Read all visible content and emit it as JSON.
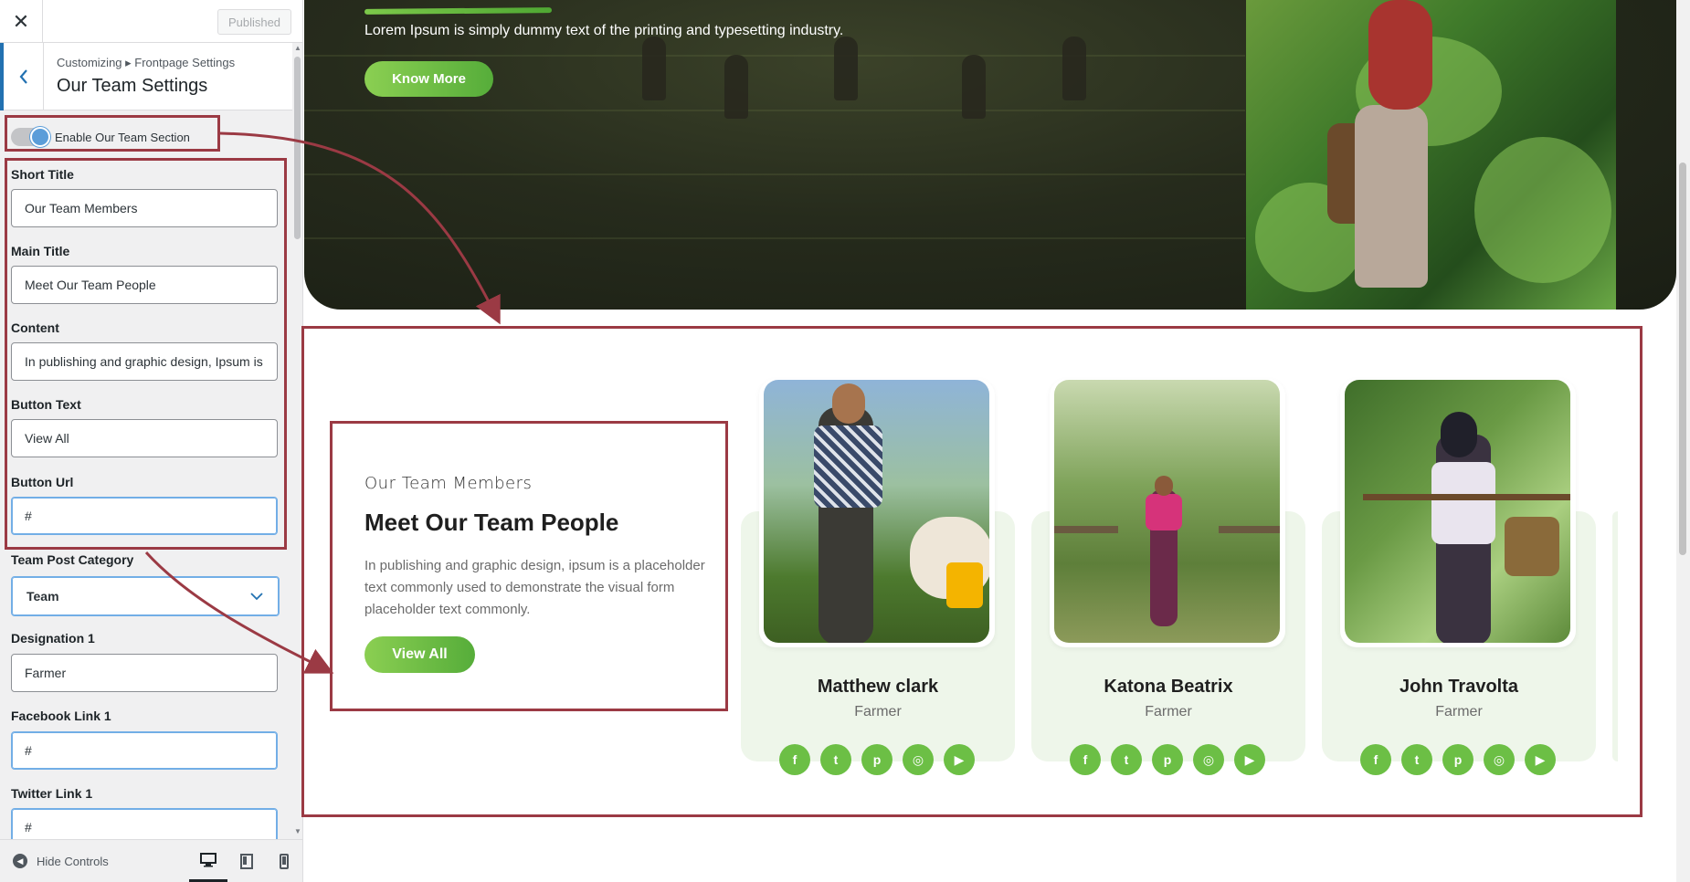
{
  "sidebar": {
    "published_label": "Published",
    "breadcrumb": "Customizing ▸ Frontpage Settings",
    "panel_title": "Our Team Settings",
    "enable_toggle_label": "Enable Our Team Section",
    "enable_toggle_on": true,
    "fields": {
      "short_title": {
        "label": "Short Title",
        "value": "Our Team Members"
      },
      "main_title": {
        "label": "Main Title",
        "value": "Meet Our Team People"
      },
      "content": {
        "label": "Content",
        "value": "In publishing and graphic design, Ipsum is"
      },
      "button_text": {
        "label": "Button Text",
        "value": "View All"
      },
      "button_url": {
        "label": "Button Url",
        "value": "#"
      },
      "team_post_category": {
        "label": "Team Post Category",
        "value": "Team"
      },
      "designation_1": {
        "label": "Designation 1",
        "value": "Farmer"
      },
      "facebook_link_1": {
        "label": "Facebook Link 1",
        "value": "#"
      },
      "twitter_link_1": {
        "label": "Twitter Link 1",
        "value": "#"
      }
    },
    "footer": {
      "hide_controls_label": "Hide Controls",
      "active_device": "desktop"
    }
  },
  "preview": {
    "hero": {
      "text": "Lorem Ipsum is simply dummy text of the printing and typesetting industry.",
      "button_label": "Know More"
    },
    "team": {
      "short_title": "Our Team Members",
      "main_title": "Meet Our Team People",
      "content": "In publishing and graphic design, ipsum is a placeholder text commonly used to demonstrate the visual form placeholder text commonly.",
      "button_label": "View All",
      "members": [
        {
          "name": "Matthew clark",
          "role": "Farmer"
        },
        {
          "name": "Katona Beatrix",
          "role": "Farmer"
        },
        {
          "name": "John Travolta",
          "role": "Farmer"
        }
      ],
      "social_icons": [
        "facebook-icon",
        "twitter-icon",
        "pinterest-icon",
        "instagram-icon",
        "youtube-icon"
      ]
    }
  },
  "colors": {
    "accent_green": "#6cbf45",
    "annotation_red": "#9b3a44",
    "wp_blue": "#2271b1",
    "card_bg": "#eef6ea"
  }
}
